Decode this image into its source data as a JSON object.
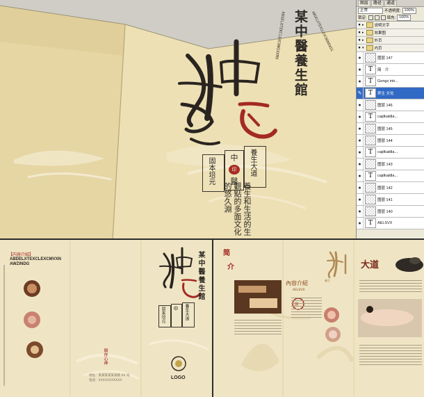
{
  "mockup": {
    "brand_vertical": "某中醫養生館",
    "latin_vertical_1": "ABSELXTEKCLEXCNWIXXMX",
    "latin_vertical_2": "ABSELXTEXCLEXCNDNEWIG",
    "calligraphy_top": "中",
    "calligraphy_main": "養生",
    "calligraphy_red": "医",
    "seal": {
      "cell_a": "固本培元",
      "cell_b": "中",
      "cell_c": "醫",
      "cell_d": "養生大道",
      "center_mark": "印"
    },
    "body_text": "養生和生活的生觀點的多面文化的悠久淵"
  },
  "ps_panel": {
    "tabs": [
      "图层",
      "路径",
      "通道"
    ],
    "blend_mode": "正常",
    "opacity_label": "不透明度:",
    "opacity_value": "100%",
    "lock_label": "锁定:",
    "fill_label": "填充:",
    "fill_value": "100%",
    "groups": [
      "说明文字",
      "效果图",
      "外页",
      "内页"
    ],
    "layers": [
      {
        "name": "图层 147",
        "type": "pixel",
        "selected": false
      },
      {
        "name": "简　介",
        "type": "text",
        "selected": false
      },
      {
        "name": "Gongs intr...",
        "type": "text",
        "selected": false
      },
      {
        "name": "养生 文化",
        "type": "text",
        "selected": true
      },
      {
        "name": "图层 146",
        "type": "pixel",
        "selected": false
      },
      {
        "name": "cajdkaldla...",
        "type": "text",
        "selected": false
      },
      {
        "name": "图层 145",
        "type": "pixel",
        "selected": false
      },
      {
        "name": "图层 144",
        "type": "pixel",
        "selected": false
      },
      {
        "name": "cajdkaldla...",
        "type": "text",
        "selected": false
      },
      {
        "name": "图层 143",
        "type": "pixel",
        "selected": false
      },
      {
        "name": "cajdkaldla...",
        "type": "text",
        "selected": false
      },
      {
        "name": "图层 142",
        "type": "pixel",
        "selected": false
      },
      {
        "name": "图层 141",
        "type": "pixel",
        "selected": false
      },
      {
        "name": "图层 140",
        "type": "pixel",
        "selected": false
      },
      {
        "name": "AELSVX",
        "type": "text",
        "selected": false
      }
    ]
  },
  "outer_spread": {
    "section_title": "【内容介紹】",
    "latin_heading": "ABDELXTEXCLEXCMVXNAWZINDG",
    "brand_vertical": "某中醫養生館",
    "calligraphy_main": "養生",
    "calligraphy_red": "医",
    "seal_left": "固本培元",
    "seal_mid": "中",
    "seal_right": "養生大道",
    "red_vertical": "順存心神",
    "contact_line1": "地址：某某某某某某路 XX 号",
    "contact_line2": "电话：XXXXXXXXXXX",
    "logo_text": "LOGO"
  },
  "inner_spread": {
    "title_1": "简",
    "title_2": "介",
    "subtitle": "內容介紹",
    "subtitle_latin": "AELSVX",
    "calligraphy": "養生",
    "big_title": "大道",
    "seal_char": "医"
  }
}
